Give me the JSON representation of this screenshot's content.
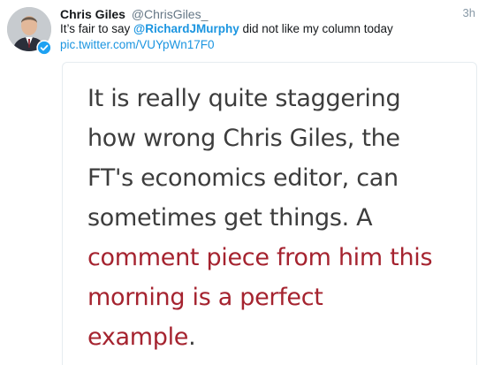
{
  "author": {
    "name": "Chris Giles",
    "handle": "@ChrisGiles_",
    "timestamp": "3h"
  },
  "tweet": {
    "text_before": "It’s fair to say ",
    "mention": "@RichardJMurphy",
    "text_after": " did not like my column today",
    "link": "pic.twitter.com/VUYpWn17F0"
  },
  "quote_image": {
    "line1": "It is really quite staggering",
    "line2": "how wrong Chris Giles, the",
    "line3": "FT's economics editor, can",
    "line4": "sometimes get things. A",
    "line5": "comment piece from him this",
    "line6": "morning is a perfect",
    "line7_text": "example",
    "line7_tail": "."
  },
  "colors": {
    "link": "#1b95e0",
    "quote_text": "#3d3d3d",
    "quote_highlight": "#a5232f",
    "verified": "#1da1f2"
  },
  "icons": {
    "verified": "verified-badge-icon"
  }
}
